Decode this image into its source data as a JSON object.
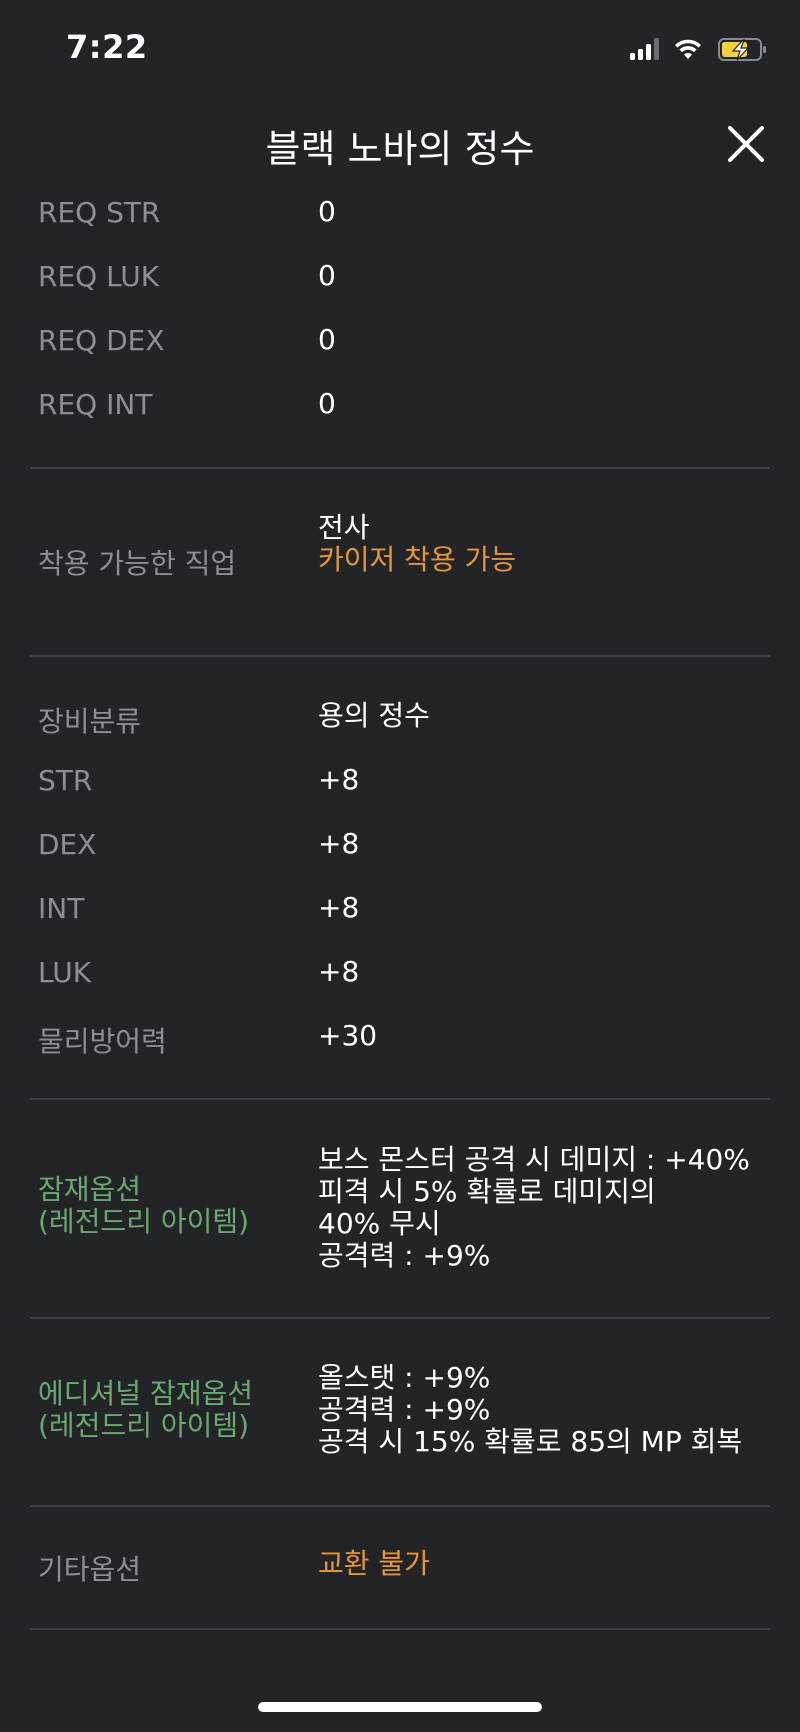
{
  "status_bar": {
    "time": "7:22"
  },
  "header": {
    "title": "블랙 노바의 정수"
  },
  "requirements": [
    {
      "label": "REQ STR",
      "value": "0"
    },
    {
      "label": "REQ LUK",
      "value": "0"
    },
    {
      "label": "REQ DEX",
      "value": "0"
    },
    {
      "label": "REQ INT",
      "value": "0"
    }
  ],
  "job": {
    "label": "착용 가능한 직업",
    "values": [
      "전사",
      "카이저 착용 가능"
    ]
  },
  "stats": [
    {
      "label": "장비분류",
      "value": "용의 정수"
    },
    {
      "label": "STR",
      "value": "+8"
    },
    {
      "label": "DEX",
      "value": "+8"
    },
    {
      "label": "INT",
      "value": "+8"
    },
    {
      "label": "LUK",
      "value": "+8"
    },
    {
      "label": "물리방어력",
      "value": "+30"
    }
  ],
  "potential": {
    "label_line1": "잠재옵션",
    "label_line2": "(레전드리 아이템)",
    "lines": [
      "보스 몬스터 공격 시 데미지 : +40%",
      "피격 시 5% 확률로 데미지의",
      "40% 무시",
      "공격력 : +9%"
    ]
  },
  "additional_potential": {
    "label_line1": "에디셔널 잠재옵션",
    "label_line2": "(레전드리 아이템)",
    "lines": [
      "올스탯 : +9%",
      "공격력 : +9%",
      "공격 시 15% 확률로 85의 MP 회복"
    ]
  },
  "other": {
    "label": "기타옵션",
    "value": "교환 불가"
  },
  "colors": {
    "background": "#232428",
    "label_gray": "#8d8f96",
    "accent_orange": "#e5963a",
    "potential_green": "#6aa870",
    "battery_yellow": "#f5d041"
  },
  "icons": {
    "signal": "cellular-signal-icon",
    "wifi": "wifi-icon",
    "battery": "battery-charging-icon",
    "close": "close-icon"
  }
}
